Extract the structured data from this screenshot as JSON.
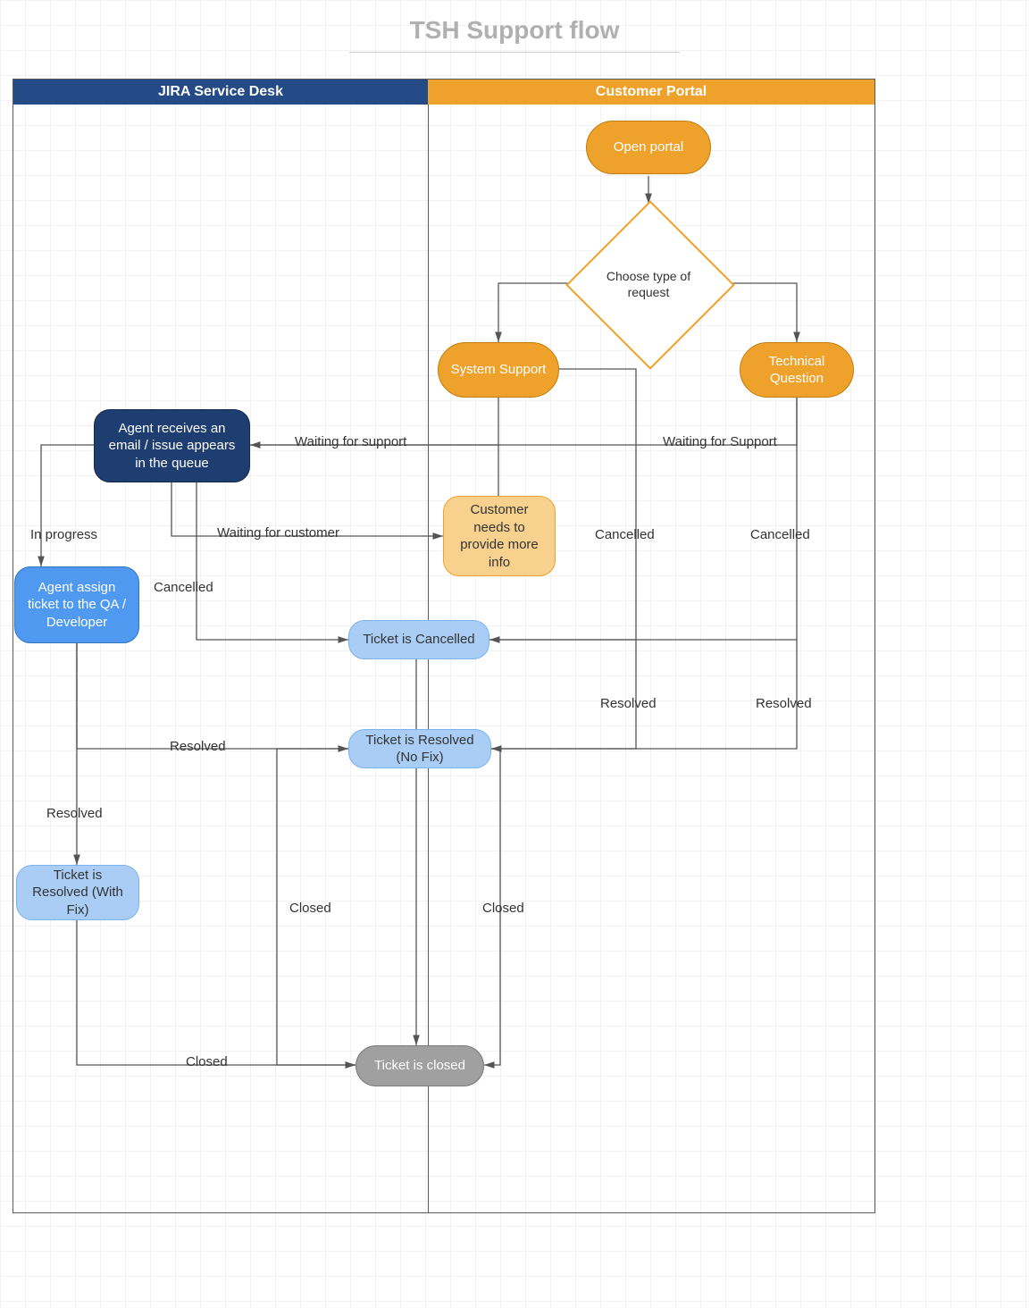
{
  "title": "TSH Support flow",
  "lanes": {
    "left": "JIRA Service Desk",
    "right": "Customer Portal"
  },
  "nodes": {
    "open_portal": "Open portal",
    "choose_type": "Choose type of request",
    "system_support": "System Support",
    "technical_question": "Technical Question",
    "agent_receives": "Agent receives an email / issue appears in the queue",
    "customer_more_info": "Customer needs to provide more info",
    "agent_assign": "Agent assign ticket to the QA / Developer",
    "ticket_cancelled": "Ticket is Cancelled",
    "ticket_resolved_nofix": "Ticket is Resolved (No Fix)",
    "ticket_resolved_withfix": "Ticket is Resolved (With Fix)",
    "ticket_closed": "Ticket is closed"
  },
  "edge_labels": {
    "waiting_for_support_left": "Waiting for support",
    "waiting_for_support_right": "Waiting for Support",
    "waiting_for_customer": "Waiting for customer",
    "in_progress": "In progress",
    "cancelled_1": "Cancelled",
    "cancelled_2": "Cancelled",
    "cancelled_3": "Cancelled",
    "resolved_1": "Resolved",
    "resolved_2": "Resolved",
    "resolved_right_1": "Resolved",
    "resolved_right_2": "Resolved",
    "closed_1": "Closed",
    "closed_2": "Closed",
    "closed_3": "Closed"
  },
  "colors": {
    "navy": "#1e3d70",
    "orange": "#efa22b",
    "orange_light": "#f7d18d",
    "blue": "#4f9af0",
    "blue_light": "#a9cdf5",
    "grey": "#a0a0a0",
    "title_grey": "#b0b0b0"
  }
}
